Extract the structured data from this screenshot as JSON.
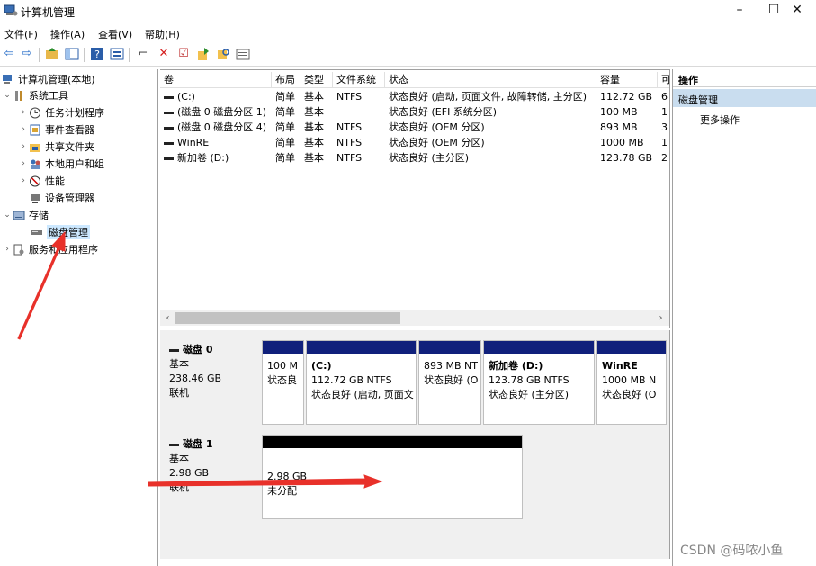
{
  "window": {
    "title": "计算机管理",
    "minimize": "–",
    "maximize": "☐",
    "close": "✕"
  },
  "menu": [
    "文件(F)",
    "操作(A)",
    "查看(V)",
    "帮助(H)"
  ],
  "tree": {
    "root": "计算机管理(本地)",
    "system_tools": "系统工具",
    "task_scheduler": "任务计划程序",
    "event_viewer": "事件查看器",
    "shared_folders": "共享文件夹",
    "local_users": "本地用户和组",
    "performance": "性能",
    "device_manager": "设备管理器",
    "storage": "存储",
    "disk_management": "磁盘管理",
    "services_apps": "服务和应用程序"
  },
  "volumes": {
    "columns": [
      "卷",
      "布局",
      "类型",
      "文件系统",
      "状态",
      "容量",
      "可"
    ],
    "rows": [
      {
        "name": "(C:)",
        "layout": "简单",
        "type": "基本",
        "fs": "NTFS",
        "status": "状态良好 (启动, 页面文件, 故障转储, 主分区)",
        "capacity": "112.72 GB",
        "free": "6"
      },
      {
        "name": "(磁盘 0 磁盘分区 1)",
        "layout": "简单",
        "type": "基本",
        "fs": "",
        "status": "状态良好 (EFI 系统分区)",
        "capacity": "100 MB",
        "free": "1"
      },
      {
        "name": "(磁盘 0 磁盘分区 4)",
        "layout": "简单",
        "type": "基本",
        "fs": "NTFS",
        "status": "状态良好 (OEM 分区)",
        "capacity": "893 MB",
        "free": "3"
      },
      {
        "name": "WinRE",
        "layout": "简单",
        "type": "基本",
        "fs": "NTFS",
        "status": "状态良好 (OEM 分区)",
        "capacity": "1000 MB",
        "free": "1"
      },
      {
        "name": "新加卷 (D:)",
        "layout": "简单",
        "type": "基本",
        "fs": "NTFS",
        "status": "状态良好 (主分区)",
        "capacity": "123.78 GB",
        "free": "2"
      }
    ],
    "scroll_left": "‹",
    "scroll_right": "›"
  },
  "disks": [
    {
      "title": "磁盘 0",
      "type": "基本",
      "size": "238.46 GB",
      "state": "联机",
      "partitions": [
        {
          "name": "",
          "line1": "100 M",
          "line2": "状态良"
        },
        {
          "name": "(C:)",
          "line1": "112.72 GB NTFS",
          "line2": "状态良好 (启动, 页面文"
        },
        {
          "name": "",
          "line1": "893 MB NT",
          "line2": "状态良好 (O"
        },
        {
          "name": "新加卷  (D:)",
          "line1": "123.78 GB NTFS",
          "line2": "状态良好 (主分区)"
        },
        {
          "name": "WinRE",
          "line1": "1000 MB N",
          "line2": "状态良好 (O"
        }
      ]
    },
    {
      "title": "磁盘 1",
      "type": "基本",
      "size": "2.98 GB",
      "state": "联机",
      "partitions": [
        {
          "name": "",
          "line1": "2.98 GB",
          "line2": "未分配"
        }
      ]
    }
  ],
  "actions": {
    "header": "操作",
    "selected": "磁盘管理",
    "more": "更多操作"
  },
  "watermark": "CSDN @码哝小鱼",
  "colors": {
    "partition_bar": "#10207b",
    "unallocated_bar": "#000000",
    "selection": "#cce8ff",
    "annotation": "#e8312a"
  }
}
